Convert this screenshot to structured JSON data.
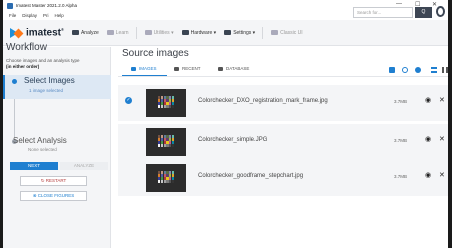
{
  "window": {
    "title": "Imatest Master 2021.2.0 Alpha",
    "minimize": "—",
    "maximize": "☐",
    "close": "✕"
  },
  "menu": [
    "File",
    "Display",
    "Pri",
    "Help"
  ],
  "toolbar": {
    "logo": "imatest",
    "logo_tm": "®",
    "items": [
      {
        "label": "Analyze",
        "icon": "chart-icon",
        "enabled": true
      },
      {
        "label": "Learn",
        "icon": "graduation-cap-icon",
        "enabled": false
      },
      {
        "label": "Utilities",
        "icon": "wrench-icon",
        "enabled": false
      },
      {
        "label": "Hardware",
        "icon": "camera-icon",
        "enabled": true
      },
      {
        "label": "Settings",
        "icon": "gear-icon",
        "enabled": true
      },
      {
        "label": "Classic UI",
        "icon": "window-icon",
        "enabled": false
      }
    ],
    "search_placeholder": "Search for...",
    "search_button": "Q"
  },
  "sidebar": {
    "title": "Workflow",
    "subtitle": "Choose images and an analysis type",
    "subtitle_bold": "(in either order)",
    "steps": [
      {
        "label": "Select Images",
        "status": "1 image selected",
        "active": true
      },
      {
        "label": "Select Analysis",
        "status": "None selected",
        "active": false
      }
    ],
    "next_label": "NEXT",
    "analyze_label": "ANALYZE",
    "restart_label": "RESTART",
    "close_label": "CLOSE FIGURES"
  },
  "main": {
    "title": "Source images",
    "tabs": [
      {
        "label": "IMAGES",
        "icon": "image-icon",
        "active": true
      },
      {
        "label": "RECENT",
        "icon": "clock-icon",
        "active": false
      },
      {
        "label": "DATABASE",
        "icon": "database-icon",
        "active": false
      }
    ],
    "files": [
      {
        "name": "Colorchecker_DXO_registration_mark_frame.jpg",
        "size": "3.7MB",
        "selected": true
      },
      {
        "name": "Colorchecker_simple.JPG",
        "size": "3.7MB",
        "selected": false
      },
      {
        "name": "Colorchecker_goodframe_stepchart.jpg",
        "size": "3.7MB",
        "selected": false
      }
    ]
  },
  "colors": {
    "accent": "#1f7fd0",
    "panel": "#f4f5f7",
    "logo_blue": "#1f8fd8",
    "logo_orange": "#ff7a1a"
  }
}
